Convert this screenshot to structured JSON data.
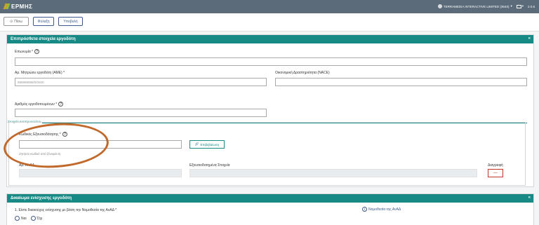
{
  "header": {
    "logo_text": "ΕΡΜΗΣ",
    "company": "TERRAMEDIA INTERACTIVE LIMITED (3640)",
    "version": "2.0.6"
  },
  "toolbar": {
    "back_label": "Πίσω",
    "save_label": "Φύλαξη",
    "submit_label": "Υποβολή"
  },
  "section1": {
    "title": "Επιπρόσθετα στοιχεία εργοδότη",
    "collapse_symbol": "«",
    "category_label": "Επωνυμία *",
    "employer_reg_label": "Αρ. Μητρώου εργοδότη (ΑΜΕ) *",
    "employer_reg_placeholder": "999999999/0/0000",
    "nace_label": "Οικονομική Δραστηριότητα (NACE)",
    "employees_label": "Αριθμός εργοδοτουμένων *",
    "auth_section_title": "Στοιχεία Αντιπροσώπου",
    "auth_code_label": "Κωδικός Εξουσιοδότησης *",
    "verify_label": "Επιβεβαίωση",
    "hint_text": "Ζητήστε κωδικό από ξένοφύντη",
    "col_ata": "Αρ. ΑπΑΔ",
    "col_authorized": "Εξουσιοδοτημένα Στοιχεία",
    "col_delete": "Διαγραφή",
    "delete_symbol": "—"
  },
  "section2": {
    "title": "Δικαίωμα ενίσχυσης εργοδότη",
    "collapse_symbol": "«",
    "question": "1. Είστε δικαιούχος ενίσχυσης με βάση την Νομοθεσία της ΑνΑΔ *",
    "opt_yes": "Ναι",
    "opt_no": "Όχι",
    "info_link": "Νομοθεσία της ΑνΑΔ"
  },
  "colors": {
    "teal": "#178a85",
    "topbar": "#5b6b79",
    "annotation": "#c1692b"
  }
}
